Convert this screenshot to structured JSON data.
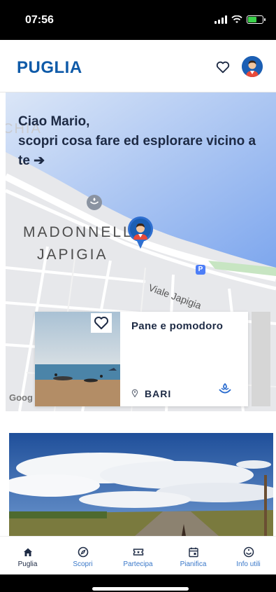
{
  "status_bar": {
    "time": "07:56"
  },
  "header": {
    "brand": "PUGLIA"
  },
  "map": {
    "greeting": "Ciao Mario,\nscopri cosa fare ed esplorare vicino a te ➔",
    "labels": [
      "MADONNELLA",
      "JAPIGIA"
    ],
    "street": "Viale Japigia",
    "attribution": "Goog"
  },
  "card": {
    "title": "Pane e pomodoro",
    "location": "BARI"
  },
  "bottom_nav": {
    "items": [
      {
        "label": "Puglia",
        "icon": "home-icon",
        "active": true
      },
      {
        "label": "Scopri",
        "icon": "compass-icon",
        "active": false
      },
      {
        "label": "Partecipa",
        "icon": "ticket-icon",
        "active": false
      },
      {
        "label": "Pianifica",
        "icon": "calendar-icon",
        "active": false
      },
      {
        "label": "Info utili",
        "icon": "info-icon",
        "active": false
      }
    ]
  },
  "colors": {
    "brand": "#0e5aa8",
    "text_dark": "#1d2a44",
    "nav_inactive": "#3a78c9"
  }
}
